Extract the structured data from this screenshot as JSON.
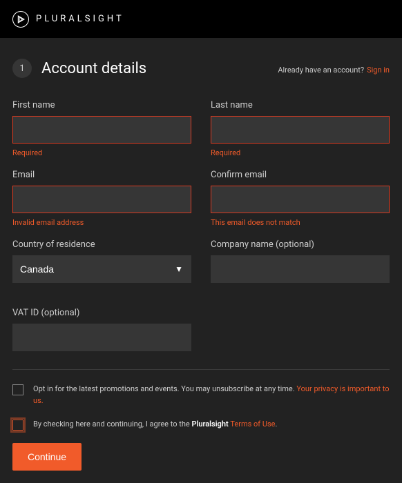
{
  "brand": "PLURALSIGHT",
  "step_number": "1",
  "page_title": "Account details",
  "signin_prompt": "Already have an account?",
  "signin_link": "Sign in",
  "fields": {
    "first_name": {
      "label": "First name",
      "value": "",
      "error": "Required"
    },
    "last_name": {
      "label": "Last name",
      "value": "",
      "error": "Required"
    },
    "email": {
      "label": "Email",
      "value": "",
      "error": "Invalid email address"
    },
    "confirm_email": {
      "label": "Confirm email",
      "value": "",
      "error": "This email does not match"
    },
    "country": {
      "label": "Country of residence",
      "value": "Canada"
    },
    "company": {
      "label": "Company name (optional)",
      "value": ""
    },
    "vat": {
      "label": "VAT ID (optional)",
      "value": ""
    }
  },
  "consent": {
    "promo_pre": "Opt in for the latest promotions and events. You may unsubscribe at any time. ",
    "promo_accent": "Your privacy is important to us.",
    "terms_pre": "By checking here and continuing, I agree to the ",
    "terms_bold": "Pluralsight",
    "terms_link": "Terms of Use",
    "terms_suffix": "."
  },
  "continue_label": "Continue",
  "colors": {
    "accent": "#f15b2a",
    "bg_dark": "#222222",
    "bg_black": "#000000",
    "input_bg": "#363636"
  }
}
